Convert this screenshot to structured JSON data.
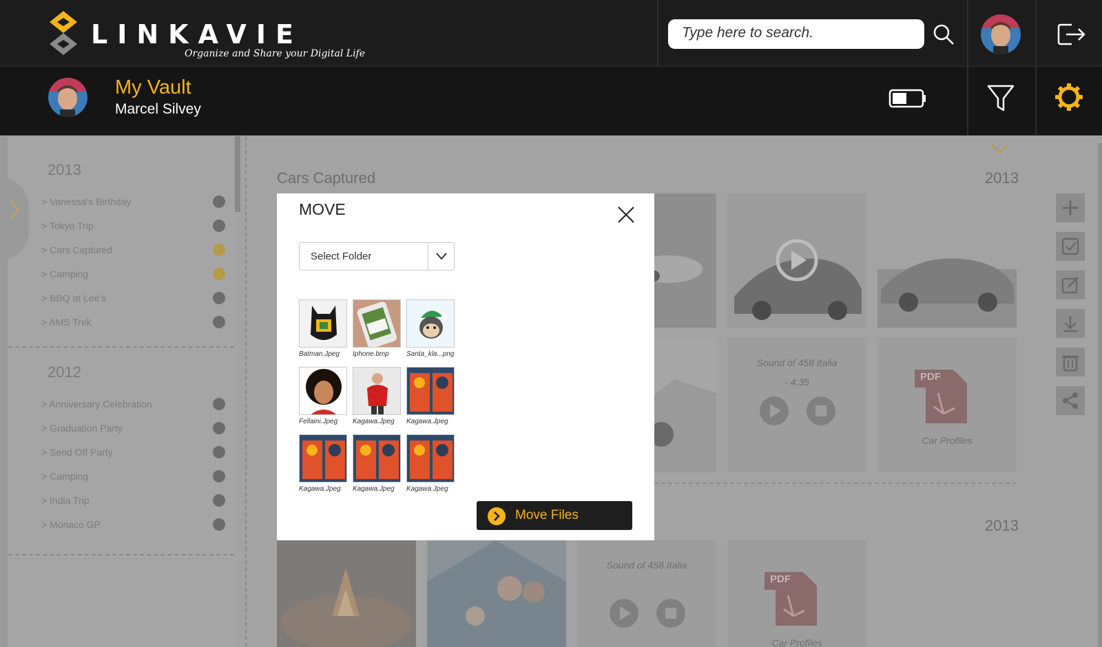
{
  "brand": {
    "name": "LINKAVIE",
    "tagline": "Organize and Share your Digital Life"
  },
  "search": {
    "placeholder": "Type here to search."
  },
  "header": {
    "vault_title": "My Vault",
    "user_name": "Marcel Silvey"
  },
  "colors": {
    "accent": "#f4b41a",
    "topbar": "#1c1c1c",
    "subbar": "#151515",
    "overlay_gray": "#a3a3a3"
  },
  "icons": {
    "search": "search-icon",
    "logout": "logout-icon",
    "battery": "battery-icon",
    "filter": "filter-icon",
    "settings": "gear-icon"
  },
  "sidebar": {
    "groups": [
      {
        "year": "2013",
        "items": [
          {
            "label": "> Vanessa's Birthday",
            "highlight": false
          },
          {
            "label": "> Tokyo Trip",
            "highlight": false
          },
          {
            "label": "> Cars Captured",
            "highlight": true
          },
          {
            "label": "> Camping",
            "highlight": true
          },
          {
            "label": "> BBQ at Lee's",
            "highlight": false
          },
          {
            "label": "> AMS Trek",
            "highlight": false
          }
        ]
      },
      {
        "year": "2012",
        "items": [
          {
            "label": "> Anniversary Celebration",
            "highlight": false
          },
          {
            "label": "> Graduation Party",
            "highlight": false
          },
          {
            "label": "> Send Off Party",
            "highlight": false
          },
          {
            "label": "> Camping",
            "highlight": false
          },
          {
            "label": "> India Trip",
            "highlight": false
          },
          {
            "label": "> Monaco GP",
            "highlight": false
          }
        ]
      }
    ]
  },
  "content": {
    "section1": {
      "title": "Cars Captured",
      "year": "2013",
      "audio_caption_line1": "Sound of  458 Italia",
      "audio_caption_line2": "- 4:35",
      "pdf_caption": "Car Profiles",
      "pdf_badge": "PDF"
    },
    "section2": {
      "year": "2013",
      "audio_caption": "Sound of  458 Italia",
      "pdf_caption": "Car Profiles",
      "pdf_badge": "PDF"
    }
  },
  "right_toolbar": [
    {
      "name": "add-icon"
    },
    {
      "name": "select-icon"
    },
    {
      "name": "edit-icon"
    },
    {
      "name": "download-icon"
    },
    {
      "name": "trash-icon"
    },
    {
      "name": "share-icon"
    }
  ],
  "modal": {
    "title": "MOVE",
    "select_label": "Select Folder",
    "files": [
      {
        "name": "Batman.Jpeg"
      },
      {
        "name": "Iphone.bmp"
      },
      {
        "name": "Santa_kla...png"
      },
      {
        "name": "Fellaini.Jpeg"
      },
      {
        "name": "Kagawa.Jpeg"
      },
      {
        "name": "Kagawa.Jpeg"
      },
      {
        "name": "Kagawa.Jpeg"
      },
      {
        "name": "Kagawa.Jpeg"
      },
      {
        "name": "Kagawa.Jpeg"
      }
    ],
    "move_button": "Move Files"
  }
}
